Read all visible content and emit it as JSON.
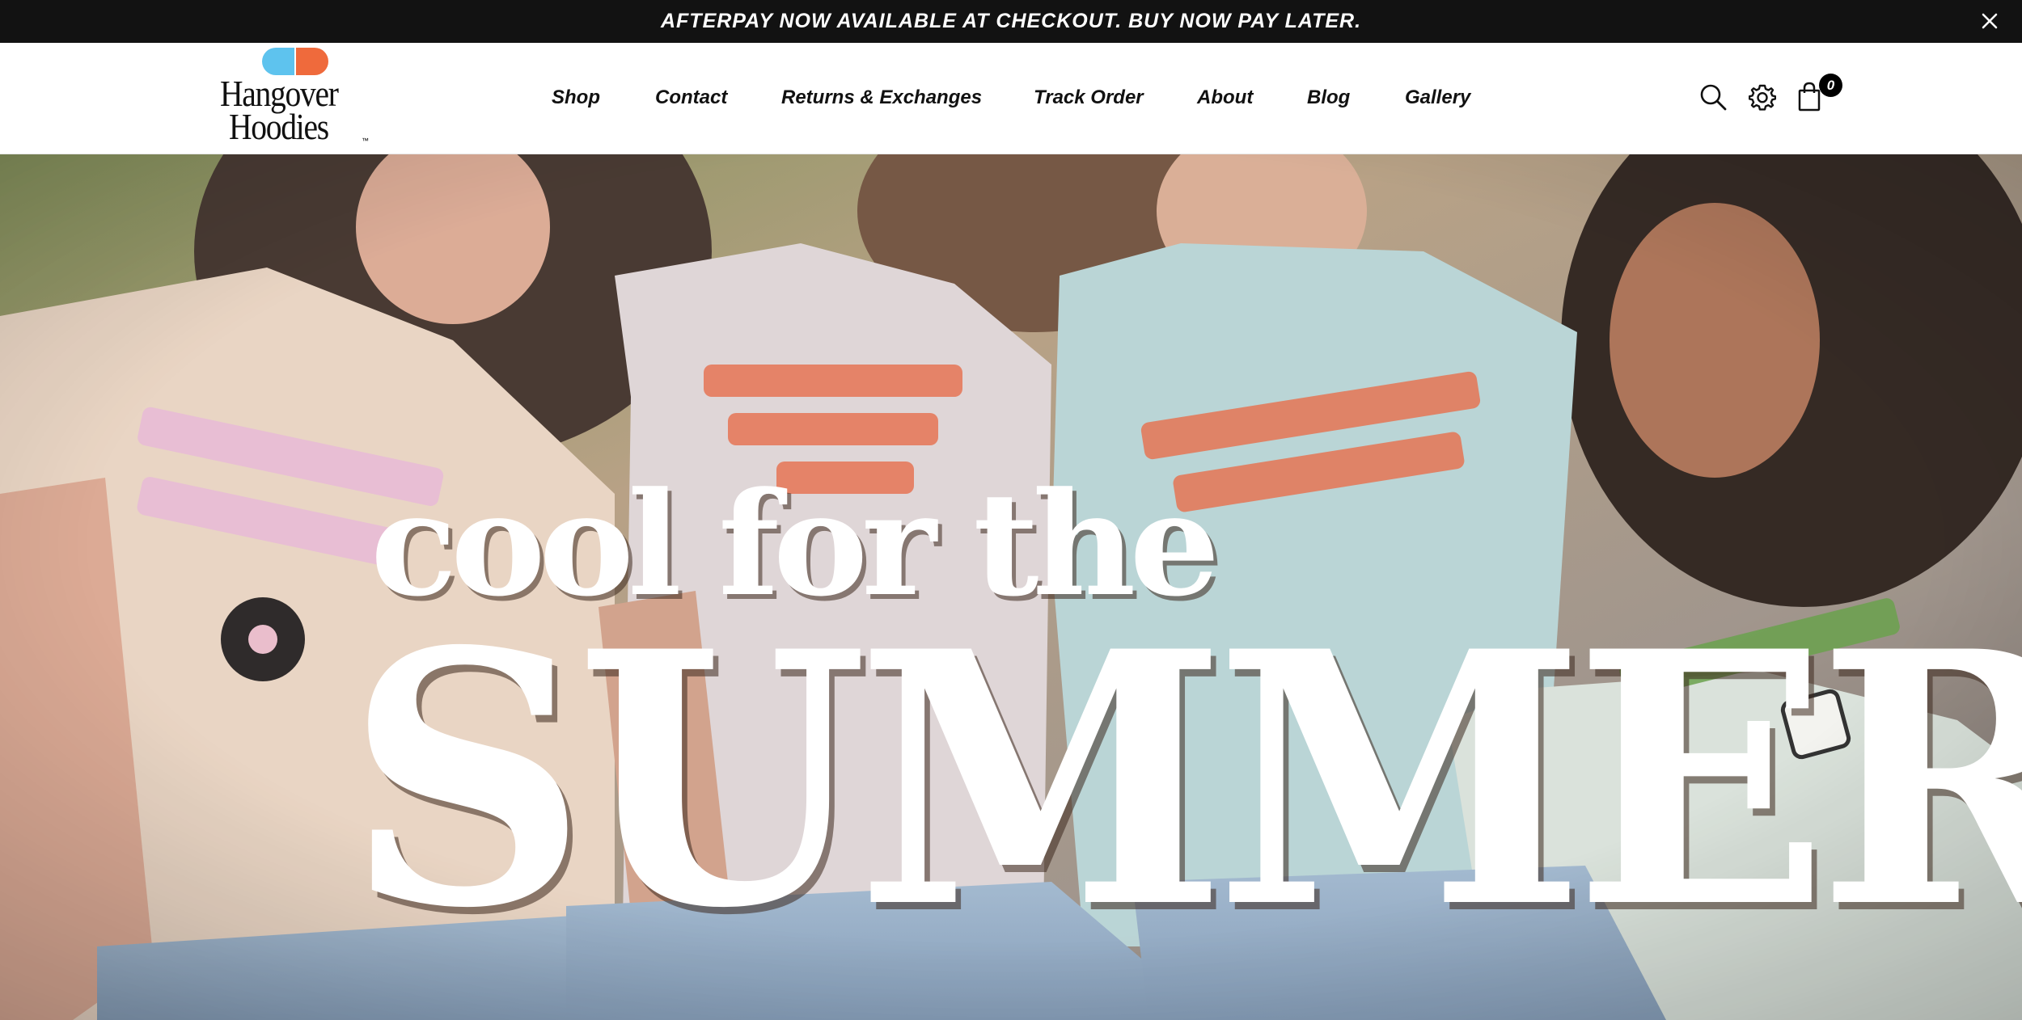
{
  "announcement": {
    "text": "AFTERPAY NOW AVAILABLE AT CHECKOUT. BUY NOW PAY LATER.",
    "close_icon": "close-icon"
  },
  "brand": {
    "name_line1": "Hangover",
    "name_line2": "Hoodies",
    "trademark": "™",
    "pill_colors": [
      "#5ec3ee",
      "#ef6a3c"
    ]
  },
  "nav": {
    "items": [
      {
        "label": "Shop"
      },
      {
        "label": "Contact"
      },
      {
        "label": "Returns & Exchanges"
      },
      {
        "label": "Track Order"
      },
      {
        "label": "About"
      },
      {
        "label": "Blog"
      },
      {
        "label": "Gallery"
      }
    ]
  },
  "header_icons": {
    "search": "search-icon",
    "settings": "gear-icon",
    "cart": "shopping-bag-icon",
    "cart_count": "0"
  },
  "hero": {
    "subtitle": "cool for the",
    "title": "SUMMER",
    "image": "group-of-friends-in-graphic-tees-photo"
  },
  "colors": {
    "announcement_bg": "#121212",
    "text": "#111111",
    "hero_text": "#ffffff"
  }
}
